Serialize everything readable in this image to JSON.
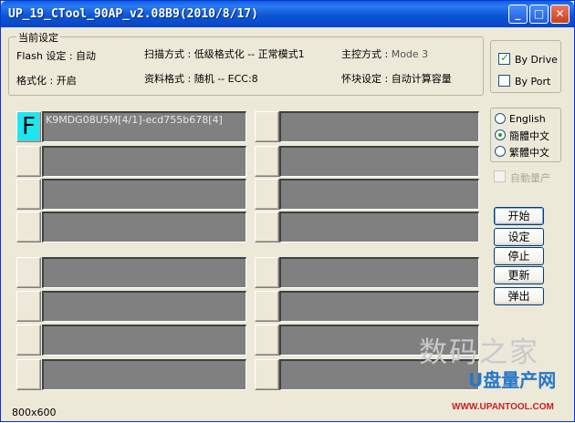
{
  "window": {
    "title": "UP_19_CTool_90AP_v2.08B9(2010/8/17)"
  },
  "title_buttons": {
    "minimize": "_",
    "maximize": "□",
    "close": "✕"
  },
  "current_settings": {
    "legend": "当前设定",
    "flash_key": "Flash 设定 : ",
    "flash_val": "自动",
    "scan_key": "扫描方式 : ",
    "scan_val": "低级格式化 -- 正常模式1",
    "controller_key": "主控方式 : ",
    "controller_val": "Mode 3",
    "format_key": "格式化 : ",
    "format_val": "开启",
    "data_format_key": "资料格式 : ",
    "data_format_val": "随机 -- ECC:8",
    "bad_block_key": "怀块设定 : ",
    "bad_block_val": "自动计算容量"
  },
  "drive_mode": {
    "by_drive": {
      "label": "By Drive",
      "checked": true
    },
    "by_port": {
      "label": "By Port",
      "checked": false
    }
  },
  "language": {
    "options": [
      "English",
      "簡體中文",
      "繁體中文"
    ],
    "selected": "簡體中文"
  },
  "auto_mass_production": {
    "label": "自動量产",
    "checked": false,
    "enabled": false
  },
  "actions": {
    "start": "开始",
    "settings": "设定",
    "stop": "停止",
    "refresh": "更新",
    "eject": "弹出"
  },
  "slots": {
    "active_letter": "F",
    "active_info": "K9MDG08U5M[4/1]-ecd755b678[4]"
  },
  "status": {
    "resolution": "800x600"
  },
  "watermark": {
    "site_name": "数码之家",
    "logo_text": "U盘量产网",
    "url": "WWW.UPANTOOL.COM"
  }
}
